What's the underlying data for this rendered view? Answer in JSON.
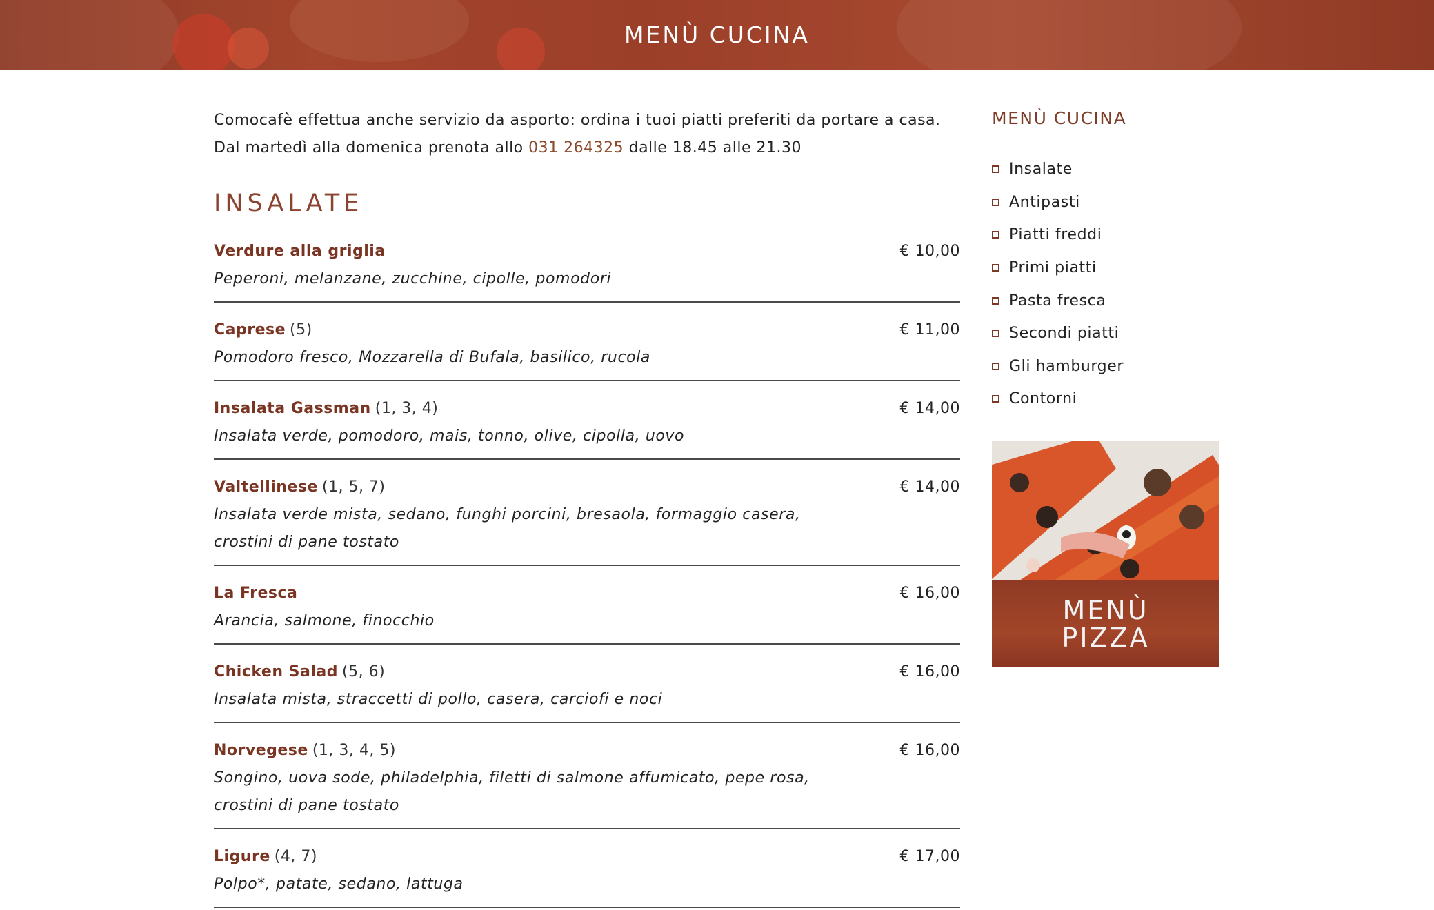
{
  "header": {
    "title": "MENÙ CUCINA"
  },
  "intro": {
    "text_before": "Comocafè effettua anche servizio da asporto: ordina i tuoi piatti preferiti da portare a casa. Dal martedì alla domenica prenota allo ",
    "phone": "031 264325",
    "text_after": " dalle 18.45 alle 21.30"
  },
  "section": {
    "title": "INSALATE",
    "items": [
      {
        "name": "Verdure alla griglia",
        "allergens": "",
        "price": "€ 10,00",
        "desc": "Peperoni, melanzane, zucchine, cipolle, pomodori"
      },
      {
        "name": "Caprese",
        "allergens": "(5)",
        "price": "€ 11,00",
        "desc": "Pomodoro fresco, Mozzarella di Bufala, basilico, rucola"
      },
      {
        "name": "Insalata Gassman",
        "allergens": "(1, 3, 4)",
        "price": "€ 14,00",
        "desc": "Insalata verde, pomodoro, mais, tonno, olive, cipolla, uovo"
      },
      {
        "name": "Valtellinese",
        "allergens": "(1, 5, 7)",
        "price": "€ 14,00",
        "desc": "Insalata verde mista, sedano, funghi porcini, bresaola, formaggio casera, crostini di pane tostato"
      },
      {
        "name": "La Fresca",
        "allergens": "",
        "price": "€ 16,00",
        "desc": "Arancia, salmone, finocchio"
      },
      {
        "name": "Chicken Salad",
        "allergens": "(5, 6)",
        "price": "€ 16,00",
        "desc": "Insalata mista, straccetti di pollo, casera, carciofi e noci"
      },
      {
        "name": "Norvegese",
        "allergens": "(1, 3, 4, 5)",
        "price": "€ 16,00",
        "desc": "Songino, uova sode, philadelphia, filetti di salmone affumicato, pepe rosa, crostini di pane tostato"
      },
      {
        "name": "Ligure",
        "allergens": "(4, 7)",
        "price": "€ 17,00",
        "desc": "Polpo*, patate, sedano, lattuga"
      }
    ]
  },
  "sidebar": {
    "title": "MENÙ CUCINA",
    "items": [
      "Insalate",
      "Antipasti",
      "Piatti freddi",
      "Primi piatti",
      "Pasta fresca",
      "Secondi piatti",
      "Gli hamburger",
      "Contorni"
    ]
  },
  "promo": {
    "line1": "MENÙ",
    "line2": "PIZZA"
  },
  "colors": {
    "accent": "#8a4430",
    "banner": "#9c3f29"
  }
}
